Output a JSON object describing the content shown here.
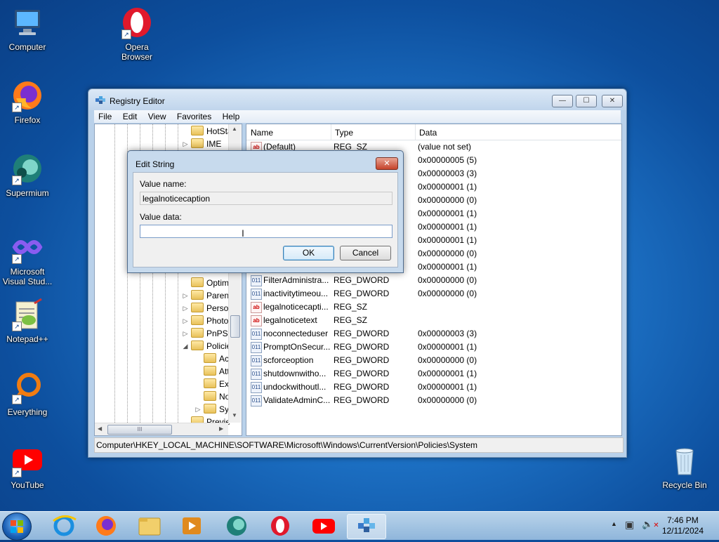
{
  "desktop": {
    "icons": [
      {
        "label": "Computer"
      },
      {
        "label": "Opera Browser"
      },
      {
        "label": "Firefox"
      },
      {
        "label": "Supermium"
      },
      {
        "label": "Microsoft Visual Stud..."
      },
      {
        "label": "Notepad++"
      },
      {
        "label": "Everything"
      },
      {
        "label": "YouTube"
      },
      {
        "label": "Recycle Bin"
      }
    ]
  },
  "window": {
    "title": "Registry Editor",
    "menu": [
      "File",
      "Edit",
      "View",
      "Favorites",
      "Help"
    ],
    "tree": [
      "HotSta",
      "IME",
      "Optim",
      "Parent",
      "Persor",
      "Photol",
      "PnPSy",
      "Policie",
      "Ac",
      "Att",
      "Exp",
      "No",
      "Sys",
      "Previe"
    ],
    "columns": {
      "name": "Name",
      "type": "Type",
      "data": "Data"
    },
    "rows": [
      {
        "name": "(Default)",
        "type": "REG_SZ",
        "data": "(value not set)",
        "kind": "sz"
      },
      {
        "name": "",
        "type": "",
        "data": "0x00000005 (5)",
        "kind": "dw"
      },
      {
        "name": "",
        "type": "",
        "data": "0x00000003 (3)",
        "kind": "dw"
      },
      {
        "name": "",
        "type": "",
        "data": "0x00000001 (1)",
        "kind": "dw"
      },
      {
        "name": "",
        "type": "",
        "data": "0x00000000 (0)",
        "kind": "dw"
      },
      {
        "name": "",
        "type": "",
        "data": "0x00000001 (1)",
        "kind": "dw"
      },
      {
        "name": "",
        "type": "",
        "data": "0x00000001 (1)",
        "kind": "dw"
      },
      {
        "name": "",
        "type": "",
        "data": "0x00000001 (1)",
        "kind": "dw"
      },
      {
        "name": "",
        "type": "",
        "data": "0x00000000 (0)",
        "kind": "dw"
      },
      {
        "name": "",
        "type": "",
        "data": "0x00000001 (1)",
        "kind": "dw"
      },
      {
        "name": "FilterAdministra...",
        "type": "REG_DWORD",
        "data": "0x00000000 (0)",
        "kind": "dw"
      },
      {
        "name": "inactivitytimeou...",
        "type": "REG_DWORD",
        "data": "0x00000000 (0)",
        "kind": "dw"
      },
      {
        "name": "legalnoticecapti...",
        "type": "REG_SZ",
        "data": "",
        "kind": "sz"
      },
      {
        "name": "legalnoticetext",
        "type": "REG_SZ",
        "data": "",
        "kind": "sz"
      },
      {
        "name": "noconnecteduser",
        "type": "REG_DWORD",
        "data": "0x00000003 (3)",
        "kind": "dw"
      },
      {
        "name": "PromptOnSecur...",
        "type": "REG_DWORD",
        "data": "0x00000001 (1)",
        "kind": "dw"
      },
      {
        "name": "scforceoption",
        "type": "REG_DWORD",
        "data": "0x00000000 (0)",
        "kind": "dw"
      },
      {
        "name": "shutdownwitho...",
        "type": "REG_DWORD",
        "data": "0x00000001 (1)",
        "kind": "dw"
      },
      {
        "name": "undockwithoutl...",
        "type": "REG_DWORD",
        "data": "0x00000001 (1)",
        "kind": "dw"
      },
      {
        "name": "ValidateAdminC...",
        "type": "REG_DWORD",
        "data": "0x00000000 (0)",
        "kind": "dw"
      }
    ],
    "status": "Computer\\HKEY_LOCAL_MACHINE\\SOFTWARE\\Microsoft\\Windows\\CurrentVersion\\Policies\\System",
    "scroll_glyph": "III"
  },
  "dialog": {
    "title": "Edit String",
    "value_name_label": "Value name:",
    "value_name": "legalnoticecaption",
    "value_data_label": "Value data:",
    "value_data": "",
    "ok": "OK",
    "cancel": "Cancel"
  },
  "taskbar": {
    "time": "7:46 PM",
    "date": "12/11/2024"
  }
}
